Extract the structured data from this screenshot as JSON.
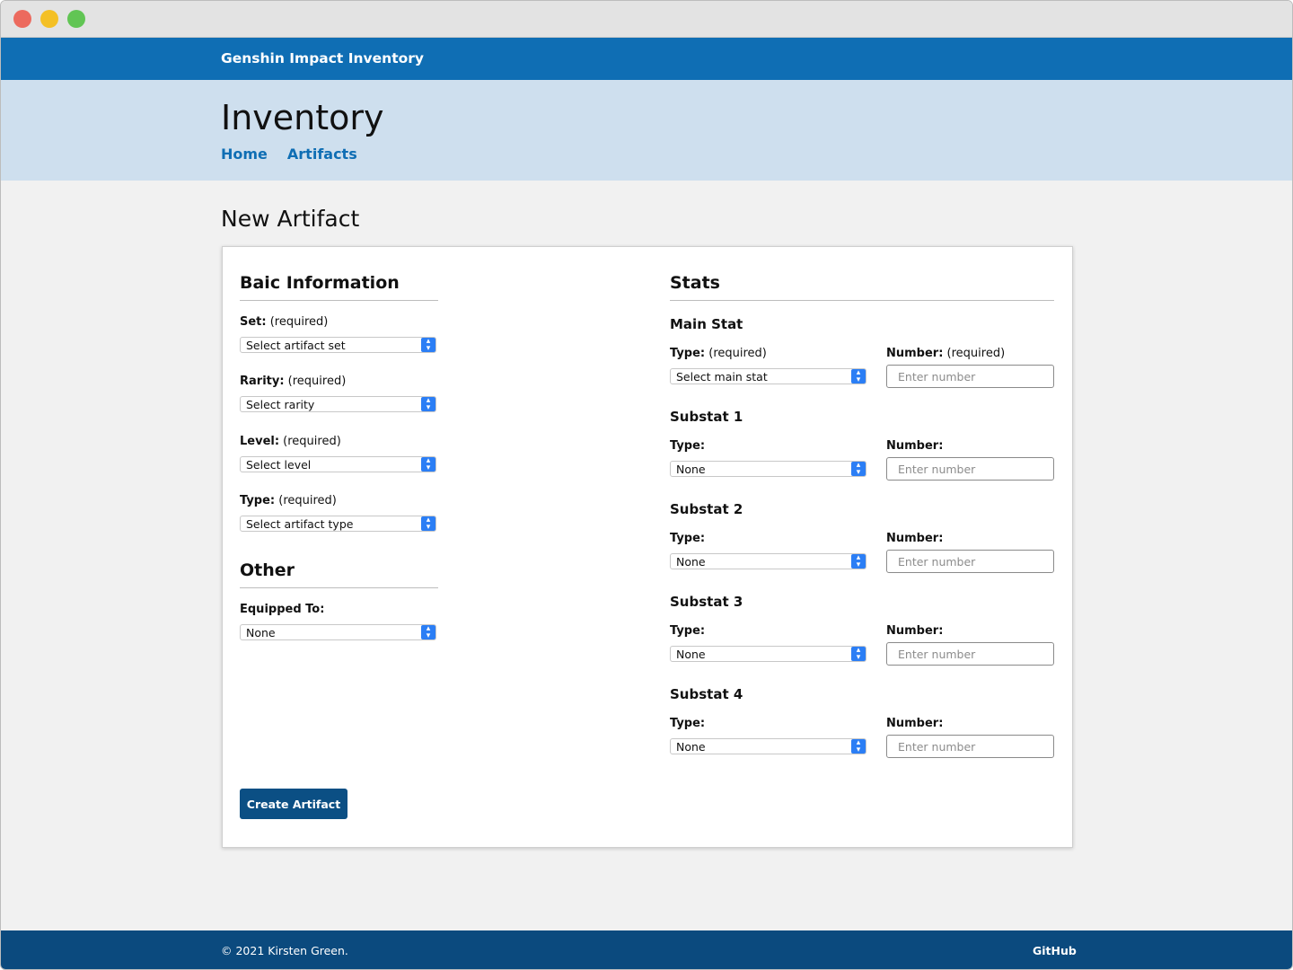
{
  "header": {
    "brand": "Genshin Impact Inventory",
    "title": "Inventory",
    "nav": [
      "Home",
      "Artifacts"
    ]
  },
  "page_title": "New Artifact",
  "basic": {
    "title": "Baic Information",
    "fields": [
      {
        "label": "Set:",
        "note": " (required)",
        "value": "Select artifact set"
      },
      {
        "label": "Rarity:",
        "note": " (required)",
        "value": "Select rarity"
      },
      {
        "label": "Level:",
        "note": " (required)",
        "value": "Select level"
      },
      {
        "label": "Type:",
        "note": " (required)",
        "value": "Select artifact type"
      }
    ]
  },
  "other": {
    "title": "Other",
    "equipped_label": "Equipped To:",
    "equipped_value": "None"
  },
  "stats": {
    "title": "Stats",
    "groups": [
      {
        "title": "Main Stat",
        "type_label": "Type:",
        "type_note": " (required)",
        "type_value": "Select main stat",
        "number_label": "Number:",
        "number_note": " (required)",
        "number_placeholder": "Enter number"
      },
      {
        "title": "Substat 1",
        "type_label": "Type:",
        "type_note": "",
        "type_value": "None",
        "number_label": "Number:",
        "number_note": "",
        "number_placeholder": "Enter number"
      },
      {
        "title": "Substat 2",
        "type_label": "Type:",
        "type_note": "",
        "type_value": "None",
        "number_label": "Number:",
        "number_note": "",
        "number_placeholder": "Enter number"
      },
      {
        "title": "Substat 3",
        "type_label": "Type:",
        "type_note": "",
        "type_value": "None",
        "number_label": "Number:",
        "number_note": "",
        "number_placeholder": "Enter number"
      },
      {
        "title": "Substat 4",
        "type_label": "Type:",
        "type_note": "",
        "type_value": "None",
        "number_label": "Number:",
        "number_note": "",
        "number_placeholder": "Enter number"
      }
    ]
  },
  "create_button": "Create Artifact",
  "footer": {
    "copyright": "© 2021 Kirsten Green.",
    "github": "GitHub"
  },
  "colors": {
    "topbar": "#0f6eb4",
    "hero": "#cedfee",
    "footer": "#0b4a7e",
    "button": "#0b4f84",
    "select_arrow": "#2b7ef5"
  }
}
